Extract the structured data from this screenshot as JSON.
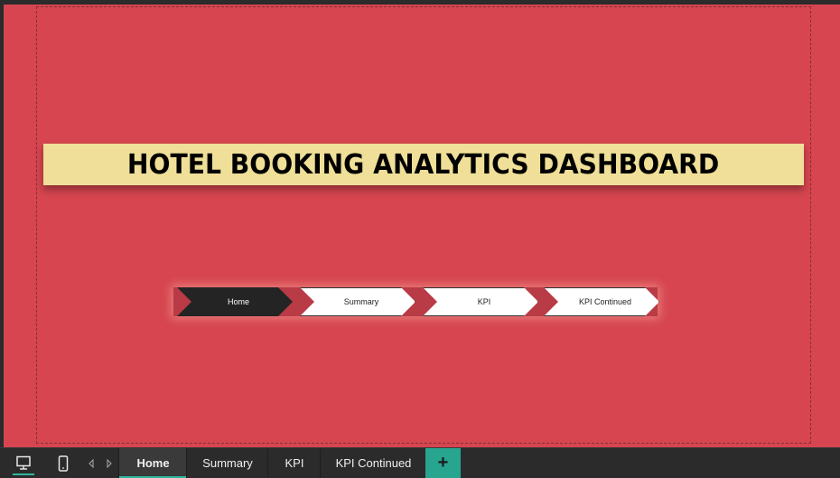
{
  "report": {
    "title": "HOTEL BOOKING ANALYTICS DASHBOARD",
    "colors": {
      "canvas": "#d64550",
      "banner": "#efdf98",
      "accent": "#2eb8a0"
    }
  },
  "navigator": {
    "buttons": [
      {
        "label": "Home",
        "state": "active"
      },
      {
        "label": "Summary",
        "state": "inactive"
      },
      {
        "label": "KPI",
        "state": "inactive"
      },
      {
        "label": "KPI Continued",
        "state": "inactive"
      }
    ]
  },
  "bottom_bar": {
    "view_buttons": [
      {
        "icon": "desktop-icon",
        "selected": true
      },
      {
        "icon": "phone-icon",
        "selected": false
      }
    ],
    "page_tabs": [
      {
        "label": "Home",
        "active": true
      },
      {
        "label": "Summary",
        "active": false
      },
      {
        "label": "KPI",
        "active": false
      },
      {
        "label": "KPI Continued",
        "active": false
      }
    ],
    "add_tab_label": "+"
  }
}
